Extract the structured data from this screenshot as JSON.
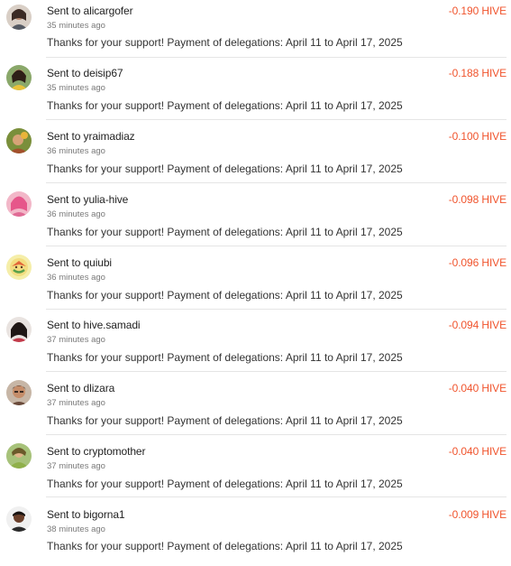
{
  "transactions": [
    {
      "title": "Sent to alicargofer",
      "time": "35 minutes ago",
      "memo": "Thanks for your support! Payment of delegations: April 11 to April 17, 2025",
      "amount": "-0.190 HIVE"
    },
    {
      "title": "Sent to deisip67",
      "time": "35 minutes ago",
      "memo": "Thanks for your support! Payment of delegations: April 11 to April 17, 2025",
      "amount": "-0.188 HIVE"
    },
    {
      "title": "Sent to yraimadiaz",
      "time": "36 minutes ago",
      "memo": "Thanks for your support! Payment of delegations: April 11 to April 17, 2025",
      "amount": "-0.100 HIVE"
    },
    {
      "title": "Sent to yulia-hive",
      "time": "36 minutes ago",
      "memo": "Thanks for your support! Payment of delegations: April 11 to April 17, 2025",
      "amount": "-0.098 HIVE"
    },
    {
      "title": "Sent to quiubi",
      "time": "36 minutes ago",
      "memo": "Thanks for your support! Payment of delegations: April 11 to April 17, 2025",
      "amount": "-0.096 HIVE"
    },
    {
      "title": "Sent to hive.samadi",
      "time": "37 minutes ago",
      "memo": "Thanks for your support! Payment of delegations: April 11 to April 17, 2025",
      "amount": "-0.094 HIVE"
    },
    {
      "title": "Sent to dlizara",
      "time": "37 minutes ago",
      "memo": "Thanks for your support! Payment of delegations: April 11 to April 17, 2025",
      "amount": "-0.040 HIVE"
    },
    {
      "title": "Sent to cryptomother",
      "time": "37 minutes ago",
      "memo": "Thanks for your support! Payment of delegations: April 11 to April 17, 2025",
      "amount": "-0.040 HIVE"
    },
    {
      "title": "Sent to bigorna1",
      "time": "38 minutes ago",
      "memo": "Thanks for your support! Payment of delegations: April 11 to April 17, 2025",
      "amount": "-0.009 HIVE"
    }
  ],
  "colors": {
    "amount": "#f0542d",
    "divider": "#e5e5e5",
    "muted_text": "#7a7a7a"
  },
  "avatars": [
    "avatar-user-photo",
    "avatar-user-photo",
    "avatar-user-photo",
    "avatar-user-photo",
    "avatar-illustration",
    "avatar-user-photo",
    "avatar-user-photo",
    "avatar-user-photo",
    "avatar-user-photo"
  ]
}
